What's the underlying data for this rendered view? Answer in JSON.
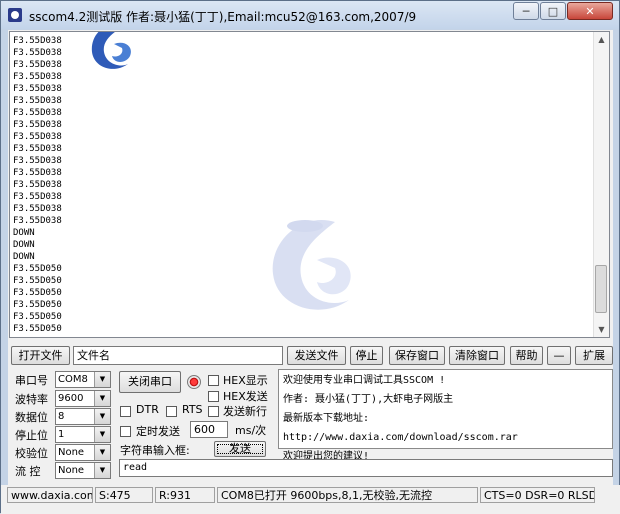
{
  "window": {
    "title": "sscom4.2测试版 作者:聂小猛(丁丁),Email:mcu52@163.com,2007/9",
    "minimize_glyph": "─",
    "maximize_glyph": "□",
    "close_glyph": "✕"
  },
  "output": {
    "lines": [
      "F3.55D038",
      "F3.55D038",
      "F3.55D038",
      "F3.55D038",
      "F3.55D038",
      "F3.55D038",
      "F3.55D038",
      "F3.55D038",
      "F3.55D038",
      "F3.55D038",
      "F3.55D038",
      "F3.55D038",
      "F3.55D038",
      "F3.55D038",
      "F3.55D038",
      "F3.55D038",
      "DOWN",
      "DOWN",
      "DOWN",
      "F3.55D050",
      "F3.55D050",
      "F3.55D050",
      "F3.55D050",
      "F3.55D050",
      "F3.55D050"
    ],
    "scroll_up": "▲",
    "scroll_down": "▼"
  },
  "toolbar": {
    "open_file": "打开文件",
    "file_name": "文件名",
    "send_file": "发送文件",
    "stop": "停止",
    "save_window": "保存窗口",
    "clear_window": "清除窗口",
    "help": "帮助",
    "collapse": "—",
    "expand": "扩展"
  },
  "settings": {
    "port_label": "串口号",
    "port_value": "COM8",
    "baud_label": "波特率",
    "baud_value": "9600",
    "databits_label": "数据位",
    "databits_value": "8",
    "stopbits_label": "停止位",
    "stopbits_value": "1",
    "parity_label": "校验位",
    "parity_value": "None",
    "flow_label": "流 控",
    "flow_value": "None",
    "close_port": "关闭串口",
    "hex_display": "HEX显示",
    "hex_send": "HEX发送",
    "dtr": "DTR",
    "rts": "RTS",
    "send_newline": "发送新行",
    "timed_send": "定时发送",
    "interval": "600",
    "interval_unit": "ms/次",
    "string_input": "字符串输入框:",
    "send": "发送",
    "input_value": "read",
    "combo_arrow": "▼"
  },
  "info": {
    "lines": [
      "欢迎使用专业串口调试工具SSCOM !",
      "作者: 聂小猛(丁丁),大虾电子网版主",
      "最新版本下载地址:",
      "http://www.daxia.com/download/sscom.rar",
      "欢迎提出您的建议!"
    ]
  },
  "status": {
    "site": "www.daxia.com",
    "sent": "S:475",
    "received": "R:931",
    "port_status": "COM8已打开  9600bps,8,1,无校验,无流控",
    "signals": "CTS=0 DSR=0 RLSD"
  }
}
